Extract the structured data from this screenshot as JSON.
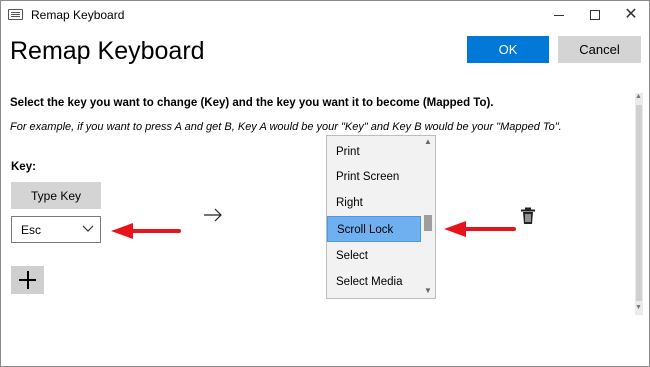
{
  "window": {
    "title": "Remap Keyboard",
    "controls": {
      "minimize": "",
      "maximize": "",
      "close": "✕"
    }
  },
  "header": {
    "heading": "Remap Keyboard",
    "ok_label": "OK",
    "cancel_label": "Cancel"
  },
  "body": {
    "instruction": "Select the key you want to change (Key) and the key you want it to become (Mapped To).",
    "example": "For example, if you want to press A and get B, Key A would be your \"Key\" and Key B would be your \"Mapped To\".",
    "key_label": "Key:",
    "type_key_label": "Type Key",
    "key_value": "Esc",
    "add_label": "+"
  },
  "mapped_to_dropdown": {
    "items": [
      "Print",
      "Print Screen",
      "Right",
      "Scroll Lock",
      "Select",
      "Select Media"
    ],
    "selected": "Scroll Lock"
  },
  "colors": {
    "accent": "#0078d7",
    "selected_item": "#6fb1f0",
    "annotation_arrow": "#e8141b"
  },
  "icons": {
    "title_icon": "keyboard-icon",
    "mapping_arrow": "arrow-right-icon",
    "delete": "trash-icon",
    "dropdown_chevron": "chevron-down-icon"
  }
}
